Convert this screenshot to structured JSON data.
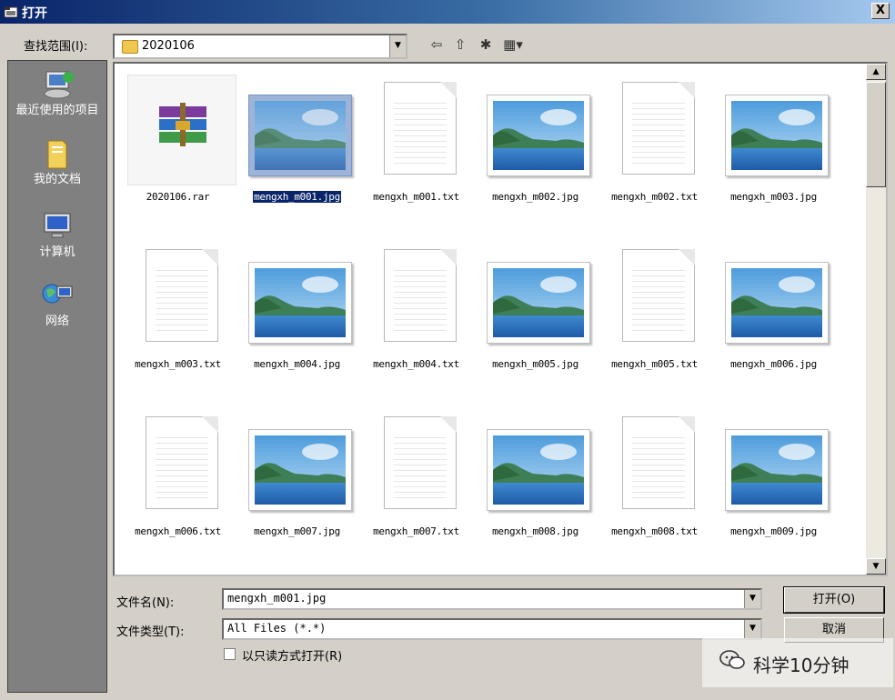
{
  "window": {
    "title": "打开",
    "close_glyph": "X"
  },
  "lookin": {
    "label": "查找范围(I):",
    "value": "2020106"
  },
  "toolbar": [
    {
      "name": "back-icon",
      "glyph": "⇦"
    },
    {
      "name": "up-folder-icon",
      "glyph": "⇧"
    },
    {
      "name": "new-folder-icon",
      "glyph": "✱"
    },
    {
      "name": "view-menu-icon",
      "glyph": "▦▾"
    }
  ],
  "places": [
    {
      "label": "最近使用的项目",
      "icon": "recent-icon"
    },
    {
      "label": "我的文档",
      "icon": "my-documents-icon"
    },
    {
      "label": "计算机",
      "icon": "computer-icon"
    },
    {
      "label": "网络",
      "icon": "network-icon"
    }
  ],
  "files": [
    {
      "name": "2020106.rar",
      "type": "rar",
      "selected": false
    },
    {
      "name": "mengxh_m001.jpg",
      "type": "jpg",
      "selected": true
    },
    {
      "name": "mengxh_m001.txt",
      "type": "txt",
      "selected": false
    },
    {
      "name": "mengxh_m002.jpg",
      "type": "jpg",
      "selected": false
    },
    {
      "name": "mengxh_m002.txt",
      "type": "txt",
      "selected": false
    },
    {
      "name": "mengxh_m003.jpg",
      "type": "jpg",
      "selected": false
    },
    {
      "name": "mengxh_m003.txt",
      "type": "txt",
      "selected": false
    },
    {
      "name": "mengxh_m004.jpg",
      "type": "jpg",
      "selected": false
    },
    {
      "name": "mengxh_m004.txt",
      "type": "txt",
      "selected": false
    },
    {
      "name": "mengxh_m005.jpg",
      "type": "jpg",
      "selected": false
    },
    {
      "name": "mengxh_m005.txt",
      "type": "txt",
      "selected": false
    },
    {
      "name": "mengxh_m006.jpg",
      "type": "jpg",
      "selected": false
    },
    {
      "name": "mengxh_m006.txt",
      "type": "txt",
      "selected": false
    },
    {
      "name": "mengxh_m007.jpg",
      "type": "jpg",
      "selected": false
    },
    {
      "name": "mengxh_m007.txt",
      "type": "txt",
      "selected": false
    },
    {
      "name": "mengxh_m008.jpg",
      "type": "jpg",
      "selected": false
    },
    {
      "name": "mengxh_m008.txt",
      "type": "txt",
      "selected": false
    },
    {
      "name": "mengxh_m009.jpg",
      "type": "jpg",
      "selected": false
    }
  ],
  "filename": {
    "label": "文件名(N):",
    "value": "mengxh_m001.jpg"
  },
  "filetype": {
    "label": "文件类型(T):",
    "value": "All Files (*.*)"
  },
  "readonly": {
    "label": "以只读方式打开(R)",
    "checked": false
  },
  "buttons": {
    "open": "打开(O)",
    "cancel": "取消"
  },
  "watermark": {
    "text": "科学10分钟"
  }
}
